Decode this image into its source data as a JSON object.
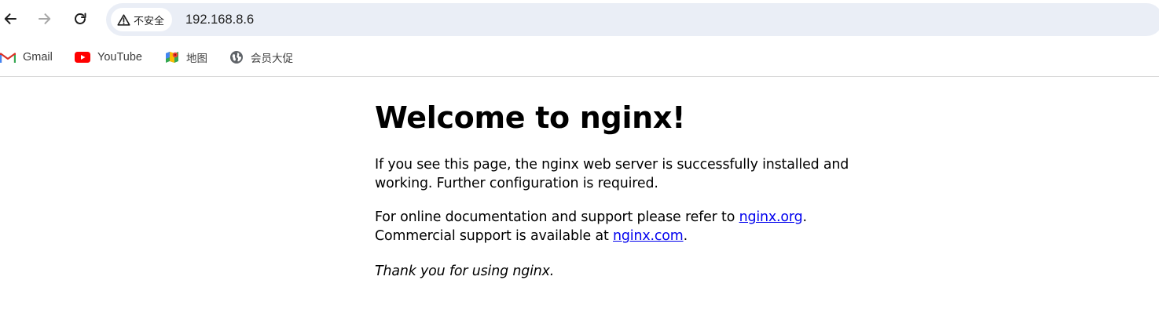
{
  "browser": {
    "security_label": "不安全",
    "url": "192.168.8.6",
    "bookmarks": [
      {
        "label": "Gmail",
        "icon": "gmail-icon"
      },
      {
        "label": "YouTube",
        "icon": "youtube-icon"
      },
      {
        "label": "地图",
        "icon": "maps-icon"
      },
      {
        "label": "会员大促",
        "icon": "globe-icon"
      }
    ],
    "colors": {
      "omnibox_bg": "#eaeef6",
      "link": "#0000ee"
    }
  },
  "page": {
    "title": "Welcome to nginx!",
    "paragraph1": "If you see this page, the nginx web server is successfully installed and working. Further configuration is required.",
    "paragraph2_prefix": "For online documentation and support please refer to ",
    "link_org": "nginx.org",
    "paragraph2_mid": ".",
    "paragraph2_line2_prefix": "Commercial support is available at ",
    "link_com": "nginx.com",
    "paragraph2_suffix": ".",
    "thanks": "Thank you for using nginx."
  }
}
